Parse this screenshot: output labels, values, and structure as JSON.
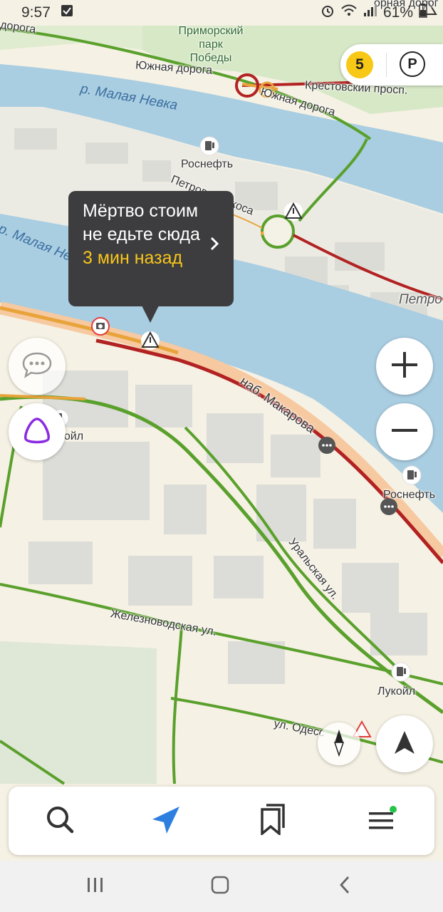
{
  "status_bar": {
    "time": "9:57",
    "battery": "61%"
  },
  "map": {
    "labels": {
      "park": "Приморский\nпарк\nПобеды",
      "yuzhnaya1": "Южная дорога",
      "yuzhnaya2": "Южная дорога",
      "krestovsky": "Крестовский просп.",
      "malaya_nevka1": "р. Малая Невка",
      "malaya_nevka2": "р. Малая Нева",
      "rosneft1": "Роснефть",
      "petrovskaya": "Петровская коса",
      "petro": "Петро",
      "makarova": "наб. Макарова",
      "lukoil1": "Лукойл",
      "rosneft2": "Роснефть",
      "uralskaya": "Уральская ул.",
      "zheleznovodskaya": "Железноводская ул.",
      "lukoil2": "Лукойл",
      "odesskaya": "ул. Одесс",
      "top_road": "дорога",
      "top_right": "орная дорог"
    }
  },
  "incident_popup": {
    "message": "Мёртво стоим не едьте сюда",
    "time_ago": "3 мин назад"
  },
  "traffic": {
    "level": "5",
    "color": "#f7c815"
  },
  "parking": {
    "label": "P"
  },
  "colors": {
    "jam": "#b22222",
    "free": "#5aa02c",
    "slow": "#e8a33a",
    "accent": "#2f7fe0",
    "water": "#a8cde2"
  },
  "bottom_nav": {
    "icons": [
      "search-icon",
      "navigation-icon",
      "bookmarks-icon",
      "menu-icon"
    ]
  },
  "android_nav": {
    "icons": [
      "recents-icon",
      "home-icon",
      "back-icon"
    ]
  }
}
